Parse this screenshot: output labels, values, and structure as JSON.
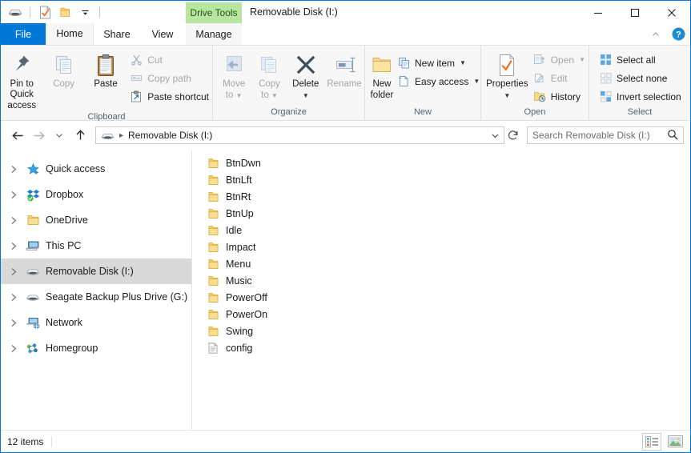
{
  "window": {
    "title": "Removable Disk (I:)",
    "accent_color": "#0078d7",
    "contextual_tab_label": "Drive Tools",
    "contextual_tab_bg": "#b8e6a0",
    "minimize_label": "Minimize",
    "maximize_label": "Maximize",
    "close_label": "Close"
  },
  "quick_access_toolbar": {
    "items": [
      {
        "name": "drive-icon",
        "label": "Removable Disk"
      },
      {
        "name": "properties-icon",
        "label": "Properties"
      },
      {
        "name": "new-folder-icon",
        "label": "New folder"
      },
      {
        "name": "chevron-down-icon",
        "label": "Customize Quick Access Toolbar"
      }
    ]
  },
  "tabs": [
    {
      "id": "file",
      "label": "File"
    },
    {
      "id": "home",
      "label": "Home"
    },
    {
      "id": "share",
      "label": "Share"
    },
    {
      "id": "view",
      "label": "View"
    },
    {
      "id": "manage",
      "label": "Manage"
    }
  ],
  "ribbon": {
    "collapse_label": "Minimize the Ribbon",
    "help_label": "Help",
    "groups": [
      {
        "id": "clipboard",
        "label": "Clipboard",
        "big_buttons": [
          {
            "id": "pin-to-quick-access",
            "line1": "Pin to Quick",
            "line2": "access",
            "disabled": false
          },
          {
            "id": "copy",
            "line1": "Copy",
            "line2": "",
            "disabled": true
          },
          {
            "id": "paste",
            "line1": "Paste",
            "line2": "",
            "disabled": false
          }
        ],
        "small_buttons": [
          {
            "id": "cut",
            "label": "Cut",
            "disabled": true
          },
          {
            "id": "copy-path",
            "label": "Copy path",
            "disabled": true
          },
          {
            "id": "paste-shortcut",
            "label": "Paste shortcut",
            "disabled": false
          }
        ]
      },
      {
        "id": "organize",
        "label": "Organize",
        "big_buttons": [
          {
            "id": "move-to",
            "line1": "Move",
            "line2": "to",
            "disabled": true,
            "caret": true
          },
          {
            "id": "copy-to",
            "line1": "Copy",
            "line2": "to",
            "disabled": true,
            "caret": true
          },
          {
            "id": "delete",
            "line1": "Delete",
            "line2": "",
            "disabled": false,
            "caret_below": true
          },
          {
            "id": "rename",
            "line1": "Rename",
            "line2": "",
            "disabled": true
          }
        ],
        "small_buttons": []
      },
      {
        "id": "new",
        "label": "New",
        "big_buttons": [
          {
            "id": "new-folder",
            "line1": "New",
            "line2": "folder",
            "disabled": false
          }
        ],
        "small_buttons": [
          {
            "id": "new-item",
            "label": "New item",
            "disabled": false,
            "caret": true
          },
          {
            "id": "easy-access",
            "label": "Easy access",
            "disabled": false,
            "caret": true
          }
        ]
      },
      {
        "id": "open",
        "label": "Open",
        "big_buttons": [
          {
            "id": "properties",
            "line1": "Properties",
            "line2": "",
            "disabled": false,
            "caret_below": true
          }
        ],
        "small_buttons": [
          {
            "id": "open",
            "label": "Open",
            "disabled": true,
            "caret": true
          },
          {
            "id": "edit",
            "label": "Edit",
            "disabled": true
          },
          {
            "id": "history",
            "label": "History",
            "disabled": false
          }
        ]
      },
      {
        "id": "select",
        "label": "Select",
        "big_buttons": [],
        "small_buttons": [
          {
            "id": "select-all",
            "label": "Select all",
            "disabled": false
          },
          {
            "id": "select-none",
            "label": "Select none",
            "disabled": false
          },
          {
            "id": "invert-selection",
            "label": "Invert selection",
            "disabled": false
          }
        ]
      }
    ]
  },
  "address_bar": {
    "back_label": "Back",
    "forward_label": "Forward",
    "recent_label": "Recent locations",
    "up_label": "Up",
    "breadcrumb": [
      "Removable Disk (I:)"
    ],
    "dropdown_label": "Previous locations",
    "refresh_label": "Refresh",
    "search_placeholder": "Search Removable Disk (I:)",
    "search_value": ""
  },
  "nav_pane": {
    "items": [
      {
        "id": "quick-access",
        "label": "Quick access",
        "icon": "star-icon",
        "selected": false
      },
      {
        "id": "dropbox",
        "label": "Dropbox",
        "icon": "dropbox-icon",
        "selected": false
      },
      {
        "id": "onedrive",
        "label": "OneDrive",
        "icon": "folder-icon",
        "selected": false
      },
      {
        "id": "this-pc",
        "label": "This PC",
        "icon": "computer-icon",
        "selected": false
      },
      {
        "id": "removable-disk",
        "label": "Removable Disk (I:)",
        "icon": "drive-icon",
        "selected": true
      },
      {
        "id": "seagate-backup",
        "label": "Seagate Backup Plus Drive (G:)",
        "icon": "drive-icon",
        "selected": false
      },
      {
        "id": "network",
        "label": "Network",
        "icon": "network-icon",
        "selected": false
      },
      {
        "id": "homegroup",
        "label": "Homegroup",
        "icon": "homegroup-icon",
        "selected": false
      }
    ]
  },
  "file_list": {
    "items": [
      {
        "name": "BtnDwn",
        "type": "folder"
      },
      {
        "name": "BtnLft",
        "type": "folder"
      },
      {
        "name": "BtnRt",
        "type": "folder"
      },
      {
        "name": "BtnUp",
        "type": "folder"
      },
      {
        "name": "Idle",
        "type": "folder"
      },
      {
        "name": "Impact",
        "type": "folder"
      },
      {
        "name": "Menu",
        "type": "folder"
      },
      {
        "name": "Music",
        "type": "folder"
      },
      {
        "name": "PowerOff",
        "type": "folder"
      },
      {
        "name": "PowerOn",
        "type": "folder"
      },
      {
        "name": "Swing",
        "type": "folder"
      },
      {
        "name": "config",
        "type": "file"
      }
    ]
  },
  "status_bar": {
    "item_count_text": "12 items",
    "details_view_label": "Details view",
    "large_icons_view_label": "Large icons view"
  }
}
